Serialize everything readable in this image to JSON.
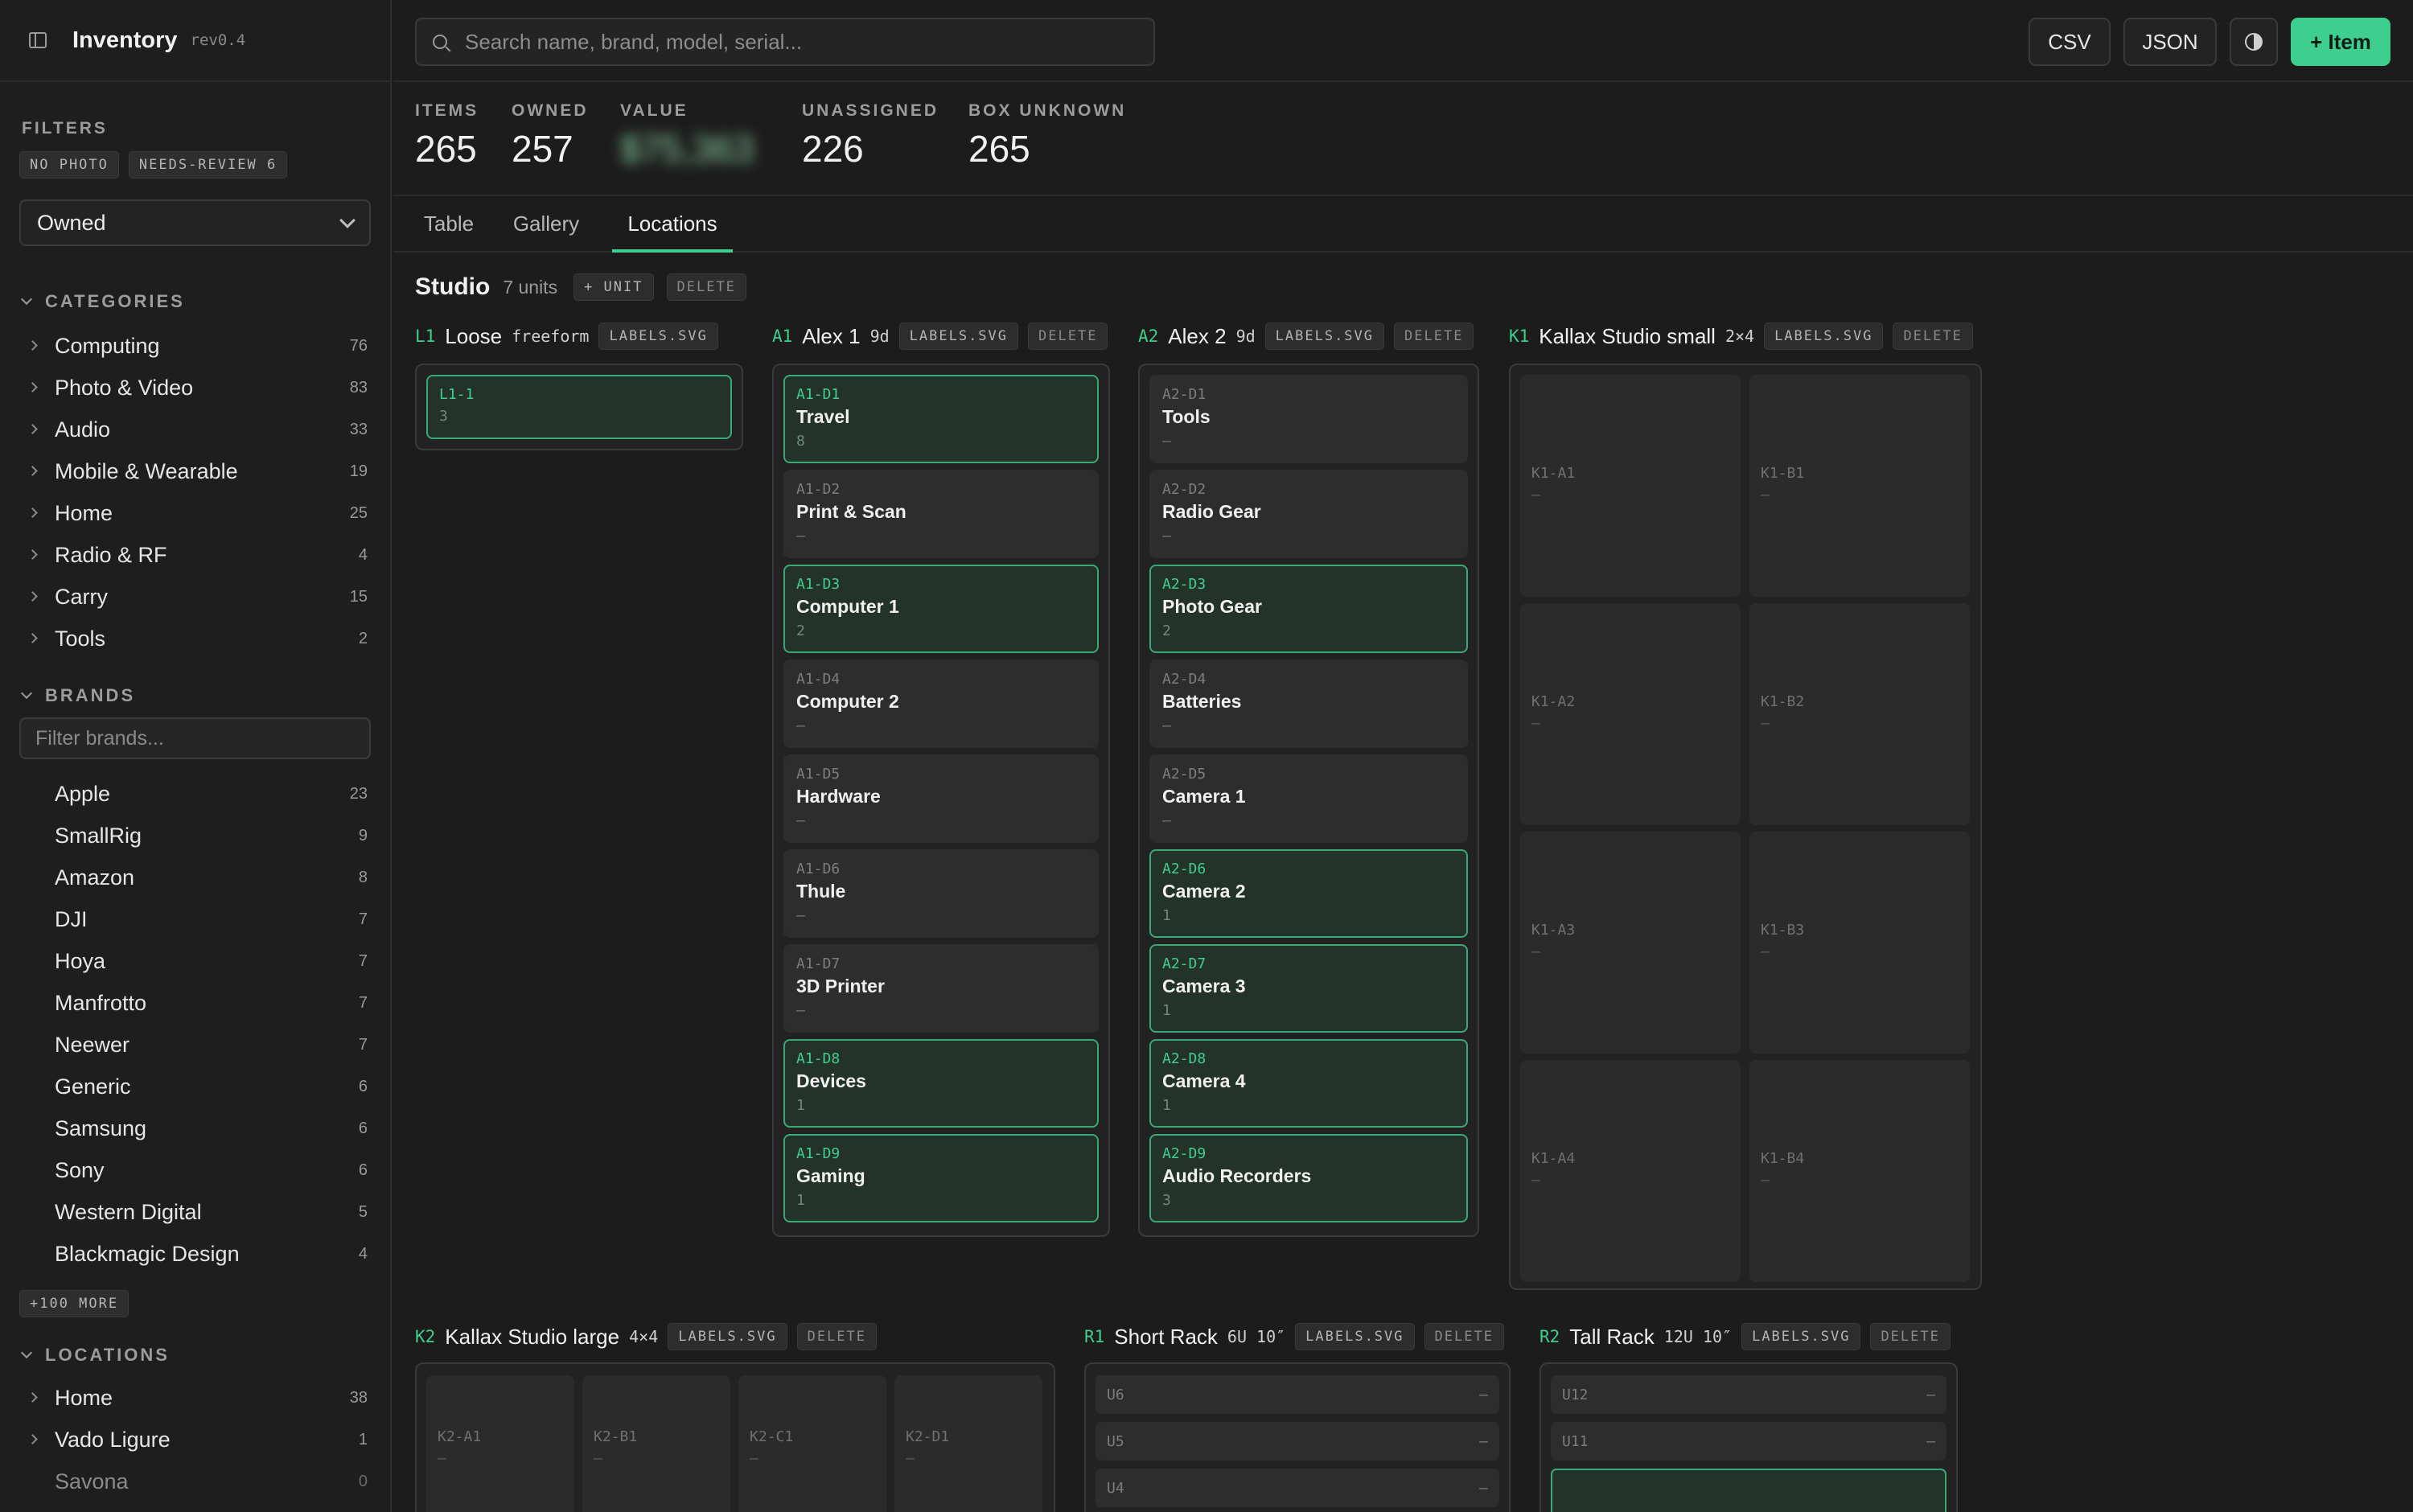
{
  "app": {
    "title": "Inventory",
    "rev": "rev0.4"
  },
  "filters": {
    "label": "FILTERS",
    "chips": [
      "NO PHOTO",
      "NEEDS-REVIEW 6"
    ],
    "ownership": "Owned"
  },
  "categories": {
    "label": "CATEGORIES",
    "items": [
      {
        "name": "Computing",
        "count": "76"
      },
      {
        "name": "Photo & Video",
        "count": "83"
      },
      {
        "name": "Audio",
        "count": "33"
      },
      {
        "name": "Mobile & Wearable",
        "count": "19"
      },
      {
        "name": "Home",
        "count": "25"
      },
      {
        "name": "Radio & RF",
        "count": "4"
      },
      {
        "name": "Carry",
        "count": "15"
      },
      {
        "name": "Tools",
        "count": "2"
      }
    ]
  },
  "brands": {
    "label": "BRANDS",
    "filter_placeholder": "Filter brands...",
    "items": [
      {
        "name": "Apple",
        "count": "23"
      },
      {
        "name": "SmallRig",
        "count": "9"
      },
      {
        "name": "Amazon",
        "count": "8"
      },
      {
        "name": "DJI",
        "count": "7"
      },
      {
        "name": "Hoya",
        "count": "7"
      },
      {
        "name": "Manfrotto",
        "count": "7"
      },
      {
        "name": "Neewer",
        "count": "7"
      },
      {
        "name": "Generic",
        "count": "6"
      },
      {
        "name": "Samsung",
        "count": "6"
      },
      {
        "name": "Sony",
        "count": "6"
      },
      {
        "name": "Western Digital",
        "count": "5"
      },
      {
        "name": "Blackmagic Design",
        "count": "4"
      }
    ],
    "more": "+100 MORE"
  },
  "locations": {
    "label": "LOCATIONS",
    "items": [
      {
        "name": "Home",
        "count": "38"
      },
      {
        "name": "Vado Ligure",
        "count": "1"
      },
      {
        "name": "Savona",
        "count": "0"
      }
    ]
  },
  "search": {
    "placeholder": "Search name, brand, model, serial..."
  },
  "toolbar": {
    "csv": "CSV",
    "json": "JSON",
    "add": "+ Item"
  },
  "stats": [
    {
      "label": "ITEMS",
      "value": "265"
    },
    {
      "label": "OWNED",
      "value": "257"
    },
    {
      "label": "VALUE",
      "value": "$75,363"
    },
    {
      "label": "UNASSIGNED",
      "value": "226"
    },
    {
      "label": "BOX UNKNOWN",
      "value": "265"
    }
  ],
  "tabs": [
    "Table",
    "Gallery",
    "Locations"
  ],
  "active_tab": "Locations",
  "studio": {
    "name": "Studio",
    "units": "7 units",
    "add_unit": "+ UNIT",
    "delete": "DELETE"
  },
  "actions": {
    "labels": "LABELS.SVG",
    "delete": "DELETE"
  },
  "units": {
    "L1": {
      "code": "L1",
      "name": "Loose",
      "meta": "freeform",
      "drawers": [
        {
          "code": "L1-1",
          "qty": "3",
          "filled": true
        }
      ]
    },
    "A1": {
      "code": "A1",
      "name": "Alex 1",
      "meta": "9d",
      "drawers": [
        {
          "code": "A1-D1",
          "name": "Travel",
          "qty": "8",
          "filled": true
        },
        {
          "code": "A1-D2",
          "name": "Print & Scan",
          "qty": "–",
          "filled": false
        },
        {
          "code": "A1-D3",
          "name": "Computer 1",
          "qty": "2",
          "filled": true
        },
        {
          "code": "A1-D4",
          "name": "Computer 2",
          "qty": "–",
          "filled": false
        },
        {
          "code": "A1-D5",
          "name": "Hardware",
          "qty": "–",
          "filled": false
        },
        {
          "code": "A1-D6",
          "name": "Thule",
          "qty": "–",
          "filled": false
        },
        {
          "code": "A1-D7",
          "name": "3D Printer",
          "qty": "–",
          "filled": false
        },
        {
          "code": "A1-D8",
          "name": "Devices",
          "qty": "1",
          "filled": true
        },
        {
          "code": "A1-D9",
          "name": "Gaming",
          "qty": "1",
          "filled": true
        }
      ]
    },
    "A2": {
      "code": "A2",
      "name": "Alex 2",
      "meta": "9d",
      "drawers": [
        {
          "code": "A2-D1",
          "name": "Tools",
          "qty": "–",
          "filled": false
        },
        {
          "code": "A2-D2",
          "name": "Radio Gear",
          "qty": "–",
          "filled": false
        },
        {
          "code": "A2-D3",
          "name": "Photo Gear",
          "qty": "2",
          "filled": true
        },
        {
          "code": "A2-D4",
          "name": "Batteries",
          "qty": "–",
          "filled": false
        },
        {
          "code": "A2-D5",
          "name": "Camera 1",
          "qty": "–",
          "filled": false
        },
        {
          "code": "A2-D6",
          "name": "Camera 2",
          "qty": "1",
          "filled": true
        },
        {
          "code": "A2-D7",
          "name": "Camera 3",
          "qty": "1",
          "filled": true
        },
        {
          "code": "A2-D8",
          "name": "Camera 4",
          "qty": "1",
          "filled": true
        },
        {
          "code": "A2-D9",
          "name": "Audio Recorders",
          "qty": "3",
          "filled": true
        }
      ]
    },
    "K1": {
      "code": "K1",
      "name": "Kallax Studio small",
      "meta": "2×4",
      "cells": [
        {
          "code": "K1-A1",
          "qty": "–"
        },
        {
          "code": "K1-B1",
          "qty": "–"
        },
        {
          "code": "K1-A2",
          "qty": "–"
        },
        {
          "code": "K1-B2",
          "qty": "–"
        },
        {
          "code": "K1-A3",
          "qty": "–"
        },
        {
          "code": "K1-B3",
          "qty": "–"
        },
        {
          "code": "K1-A4",
          "qty": "–"
        },
        {
          "code": "K1-B4",
          "qty": "–"
        }
      ]
    },
    "K2": {
      "code": "K2",
      "name": "Kallax Studio large",
      "meta": "4×4",
      "cells": [
        {
          "code": "K2-A1",
          "qty": "–"
        },
        {
          "code": "K2-B1",
          "qty": "–"
        },
        {
          "code": "K2-C1",
          "qty": "–"
        },
        {
          "code": "K2-D1",
          "qty": "–"
        }
      ]
    },
    "R1": {
      "code": "R1",
      "name": "Short Rack",
      "meta": "6U 10″",
      "rows": [
        {
          "code": "U6",
          "qty": "–"
        },
        {
          "code": "U5",
          "qty": "–"
        },
        {
          "code": "U4",
          "qty": "–"
        }
      ]
    },
    "R2": {
      "code": "R2",
      "name": "Tall Rack",
      "meta": "12U 10″",
      "rows": [
        {
          "code": "U12",
          "qty": "–"
        },
        {
          "code": "U11",
          "qty": "–"
        }
      ]
    }
  },
  "colors": {
    "accent": "#3ecf8e",
    "background": "#1c1c1c",
    "sidebar": "#1e1e1e"
  }
}
